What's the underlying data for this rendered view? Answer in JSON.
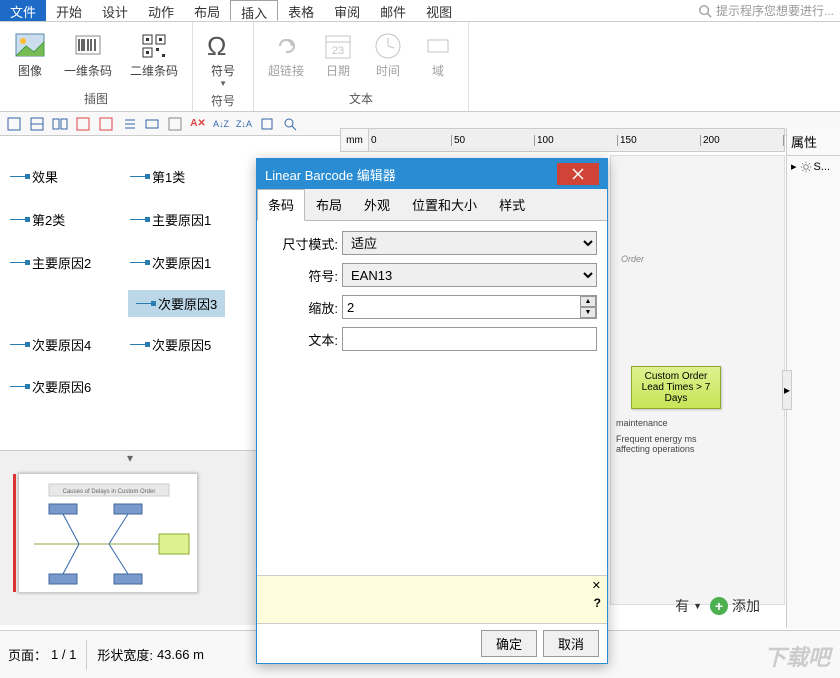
{
  "ribbon": {
    "tabs": {
      "file": "文件",
      "start": "开始",
      "design": "设计",
      "action": "动作",
      "layout": "布局",
      "insert": "插入",
      "table": "表格",
      "review": "审阅",
      "mail": "邮件",
      "view": "视图"
    },
    "search_placeholder": "提示程序您想要进行...",
    "groups": {
      "illustration": {
        "label": "插图",
        "image": "图像",
        "barcode1d": "一维条码",
        "barcode2d": "二维条码"
      },
      "symbol": {
        "label": "符号",
        "symbol": "符号"
      },
      "text": {
        "label": "文本",
        "hyperlink": "超链接",
        "date": "日期",
        "time": "时间",
        "field": "域"
      }
    }
  },
  "ruler": {
    "unit": "mm",
    "ticks": [
      "0",
      "50",
      "100",
      "150",
      "200"
    ]
  },
  "tree": {
    "n0": "效果",
    "n1": "第1类",
    "n2": "第2类",
    "n3": "主要原因1",
    "n4": "主要原因2",
    "n5": "次要原因1",
    "n6": "次要原因3",
    "n7": "次要原因4",
    "n8": "次要原因5",
    "n9": "次要原因6"
  },
  "thumb": {
    "title": "Causes of Delays in Custom Order"
  },
  "canvas": {
    "order_label": "Order",
    "card1": "Custom Order Lead Times > 7 Days",
    "note1": "maintenance",
    "note2": "Frequent energy ms affecting operations"
  },
  "props": {
    "header": "属性",
    "s": "S..."
  },
  "status": {
    "page_label": "页面：",
    "page_value": "1 / 1",
    "shape_width_label": "形状宽度:",
    "shape_width_value": "43.66 m"
  },
  "bottom_controls": {
    "you": "有",
    "add": "添加"
  },
  "watermark": "下载吧",
  "dialog": {
    "title": "Linear Barcode 编辑器",
    "tabs": {
      "barcode": "条码",
      "layout": "布局",
      "appearance": "外观",
      "pos_size": "位置和大小",
      "style": "样式"
    },
    "fields": {
      "size_mode_label": "尺寸模式:",
      "size_mode_value": "适应",
      "symbol_label": "符号:",
      "symbol_value": "EAN13",
      "zoom_label": "缩放:",
      "zoom_value": "2",
      "text_label": "文本:",
      "text_value": ""
    },
    "ok": "确定",
    "cancel": "取消"
  }
}
